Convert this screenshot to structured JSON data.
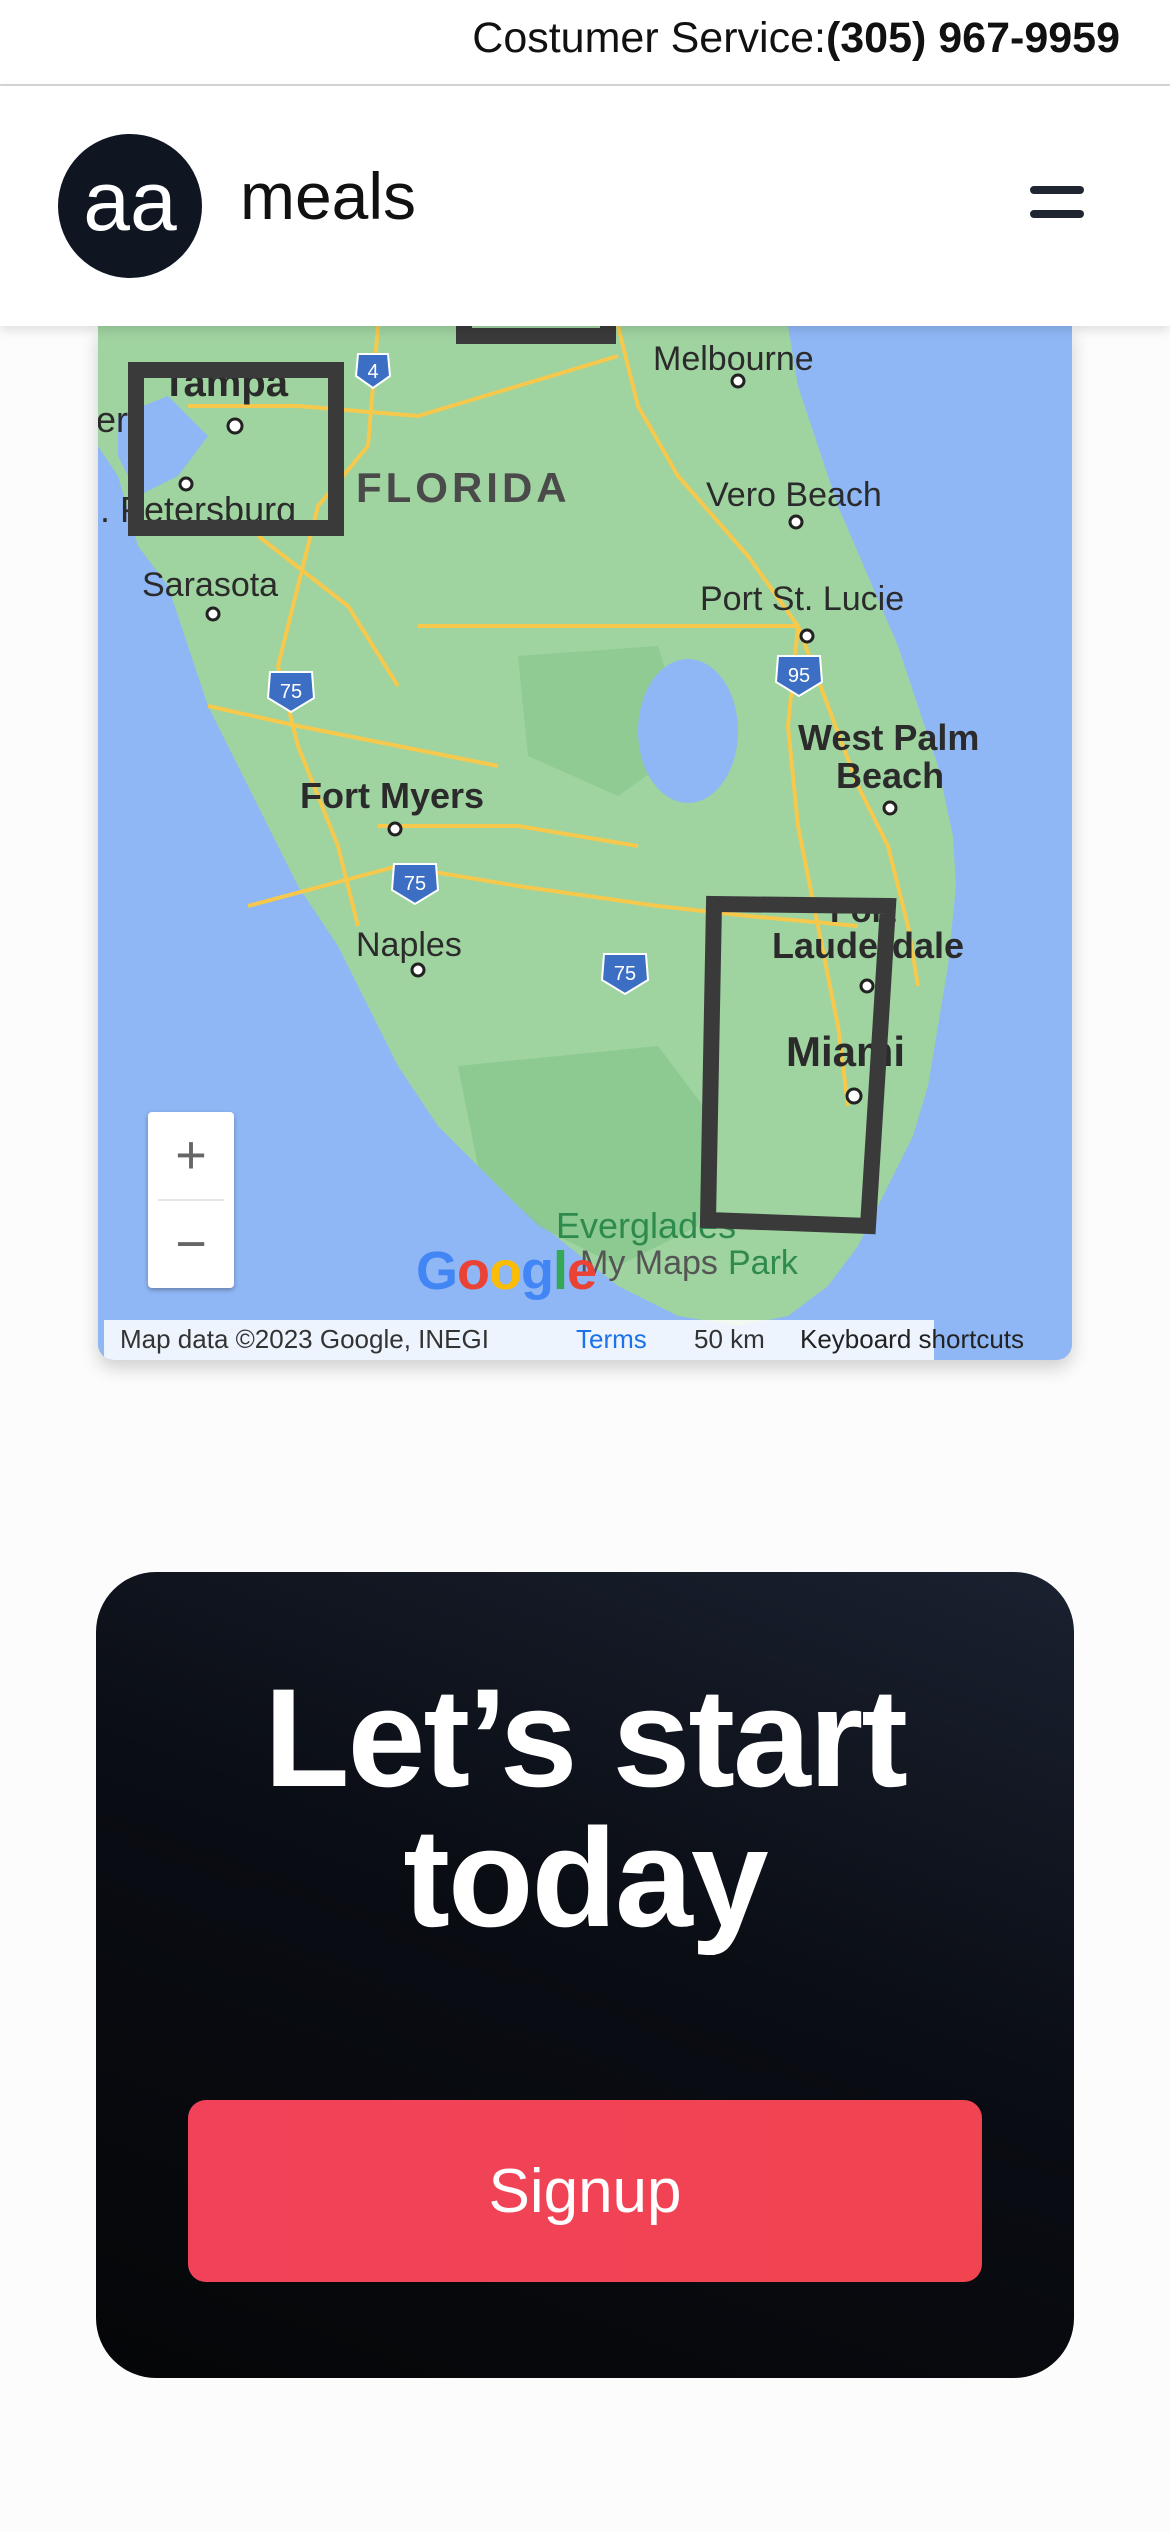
{
  "topbar": {
    "service_label": "Costumer Service:",
    "phone": "(305) 967-9959"
  },
  "header": {
    "logo_text": "aa",
    "brand": "meals",
    "menu_icon": "hamburger-menu-icon"
  },
  "map": {
    "labels": {
      "tampa": "Tampa",
      "st_petersburg": ". Petersburg",
      "edge_left": "er",
      "florida": "FLORIDA",
      "melbourne": "Melbourne",
      "vero_beach": "Vero Beach",
      "sarasota": "Sarasota",
      "port_st_lucie": "Port St. Lucie",
      "west_palm_1": "West Palm",
      "west_palm_2": "Beach",
      "fort_myers": "Fort Myers",
      "naples": "Naples",
      "fort_lauderdale_1": "Fort",
      "fort_lauderdale_2": "Lauderdale",
      "miami": "Miami",
      "everglades": "Everglades",
      "mymaps": "My Maps",
      "park": "Park"
    },
    "shields": {
      "i4": "4",
      "i75_north": "75",
      "i95": "95",
      "i75_south": "75",
      "i75_alley": "75"
    },
    "zoom_in": "+",
    "zoom_out": "−",
    "google_logo": "Google",
    "attribution": "Map data ©2023 Google, INEGI",
    "terms": "Terms",
    "scale": "50 km",
    "shortcuts": "Keyboard shortcuts",
    "colors": {
      "water": "#8fb7f5",
      "land": "#9fd3a0",
      "highway": "#f6c94d",
      "interstate": "#3c6fc4",
      "region_outline": "#3a3a3a"
    }
  },
  "cta": {
    "title_line1": "Let’s start",
    "title_line2": "today",
    "signup_label": "Signup"
  }
}
